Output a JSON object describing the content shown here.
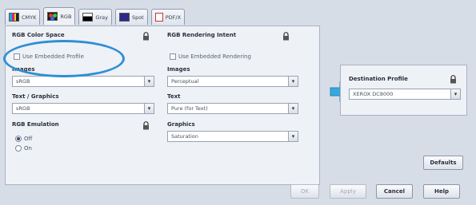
{
  "tabs": [
    {
      "label": "CMYK",
      "icon": "cmyk-swatch-icon"
    },
    {
      "label": "RGB",
      "icon": "rgb-swatch-icon"
    },
    {
      "label": "Gray",
      "icon": "gray-swatch-icon"
    },
    {
      "label": "Spot",
      "icon": "spot-swatch-icon"
    },
    {
      "label": "PDF/X",
      "icon": "pdfx-doc-icon"
    }
  ],
  "active_tab": "RGB",
  "color_space": {
    "heading": "RGB Color Space",
    "use_embedded_label": "Use Embedded Profile",
    "use_embedded_checked": false,
    "images_label": "Images",
    "images_value": "sRGB",
    "text_graphics_label": "Text / Graphics",
    "text_graphics_value": "sRGB",
    "emulation_label": "RGB Emulation",
    "emulation_options": [
      "Off",
      "On"
    ],
    "emulation_selected": "Off"
  },
  "rendering_intent": {
    "heading": "RGB Rendering Intent",
    "use_embedded_label": "Use Embedded Rendering",
    "use_embedded_checked": false,
    "images_label": "Images",
    "images_value": "Perceptual",
    "text_label": "Text",
    "text_value": "Pure (for Text)",
    "graphics_label": "Graphics",
    "graphics_value": "Saturation"
  },
  "destination": {
    "heading": "Destination Profile",
    "value": "XEROX DC8000"
  },
  "buttons": {
    "defaults": "Defaults",
    "ok": "OK",
    "apply": "Apply",
    "cancel": "Cancel",
    "help": "Help"
  },
  "colors": {
    "highlight_ellipse": "#2f8fd4",
    "arrow": "#3aa7dd",
    "panel_bg": "#eef1f6"
  }
}
